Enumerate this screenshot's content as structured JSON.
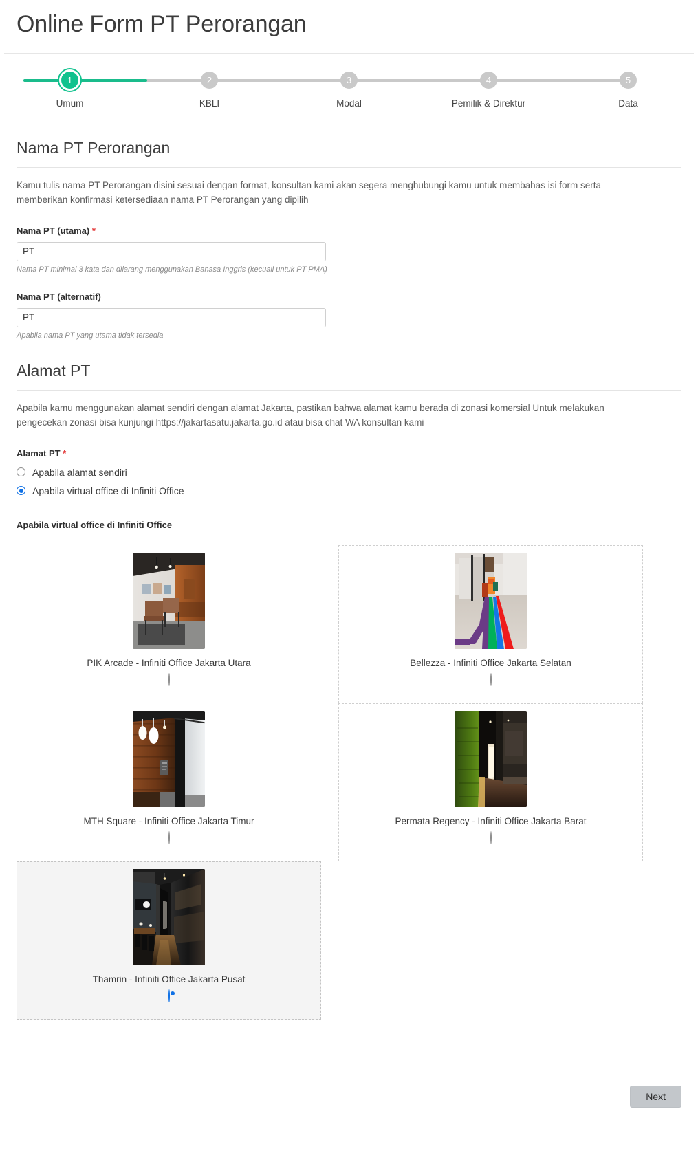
{
  "header": {
    "title": "Online Form PT Perorangan"
  },
  "stepper": {
    "active_index": 0,
    "accent_color": "#11c28e",
    "inactive_color": "#c9c9c9",
    "steps": [
      {
        "number": "1",
        "label": "Umum"
      },
      {
        "number": "2",
        "label": "KBLI"
      },
      {
        "number": "3",
        "label": "Modal"
      },
      {
        "number": "4",
        "label": "Pemilik & Direktur"
      },
      {
        "number": "5",
        "label": "Data"
      }
    ]
  },
  "section_nama": {
    "title": "Nama PT Perorangan",
    "description": "Kamu tulis nama PT Perorangan disini sesuai dengan format, konsultan kami akan segera menghubungi kamu untuk membahas isi form serta memberikan konfirmasi ketersediaan nama PT Perorangan yang dipilih",
    "utama": {
      "label": "Nama PT (utama)",
      "required_mark": "*",
      "value": "PT",
      "placeholder": "PT",
      "hint": "Nama PT minimal 3 kata dan dilarang menggunakan Bahasa Inggris (kecuali untuk PT PMA)"
    },
    "alternatif": {
      "label": "Nama PT (alternatif)",
      "value": "PT",
      "placeholder": "PT",
      "hint": "Apabila nama PT yang utama tidak tersedia"
    }
  },
  "section_alamat": {
    "title": "Alamat PT",
    "description": "Apabila kamu menggunakan alamat sendiri dengan alamat Jakarta, pastikan bahwa alamat kamu berada di zonasi komersial Untuk melakukan pengecekan zonasi bisa kunjungi https://jakartasatu.jakarta.go.id atau bisa chat WA konsultan kami",
    "radio_label": "Alamat PT",
    "required_mark": "*",
    "radio_accent": "#1071e5",
    "options": [
      {
        "label": "Apabila alamat sendiri",
        "checked": false
      },
      {
        "label": "Apabila virtual office di Infiniti Office",
        "checked": true
      }
    ]
  },
  "office_picker": {
    "label": "Apabila virtual office di Infiniti Office",
    "options": [
      {
        "name": "PIK Arcade - Infiniti Office Jakarta Utara",
        "image": "office-lounge-chairs-photo",
        "checked": false,
        "bordered": false,
        "selected": false
      },
      {
        "name": "Bellezza - Infiniti Office Jakarta Selatan",
        "image": "corridor-color-stripes-photo",
        "checked": false,
        "bordered": true,
        "selected": false
      },
      {
        "name": "MTH Square - Infiniti Office Jakarta Timur",
        "image": "wood-wall-pendant-lights-photo",
        "checked": false,
        "bordered": false,
        "selected": false
      },
      {
        "name": "Permata Regency - Infiniti Office Jakarta Barat",
        "image": "green-moss-wall-corridor-photo",
        "checked": false,
        "bordered": true,
        "selected": false
      },
      {
        "name": "Thamrin - Infiniti Office Jakarta Pusat",
        "image": "dark-meeting-room-photo",
        "checked": true,
        "bordered": true,
        "selected": true
      }
    ]
  },
  "footer": {
    "next_label": "Next"
  }
}
